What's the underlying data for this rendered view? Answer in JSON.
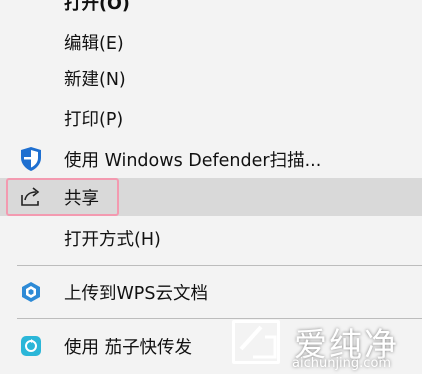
{
  "menu": {
    "items": [
      {
        "label": "打开(O)"
      },
      {
        "label": "编辑(E)"
      },
      {
        "label": "新建(N)"
      },
      {
        "label": "打印(P)"
      },
      {
        "label": "使用 Windows Defender扫描..."
      },
      {
        "label": "共享"
      },
      {
        "label": "打开方式(H)"
      },
      {
        "label": "上传到WPS云文档"
      },
      {
        "label": "使用 茄子快传发"
      }
    ]
  },
  "colors": {
    "menu_bg": "#f3f3f3",
    "hover_bg": "#d9d9d9",
    "highlight_border": "#f39ab0",
    "defender_blue": "#1e6fd0",
    "wps_blue": "#2d8ad6",
    "qiezi_teal": "#2bb6d8"
  },
  "icons": {
    "defender": "shield-icon",
    "share": "share-icon",
    "wps": "cube-icon",
    "qiezi": "transfer-icon"
  },
  "watermark": {
    "title": "爱纯净",
    "url": "aichunjing.com"
  }
}
